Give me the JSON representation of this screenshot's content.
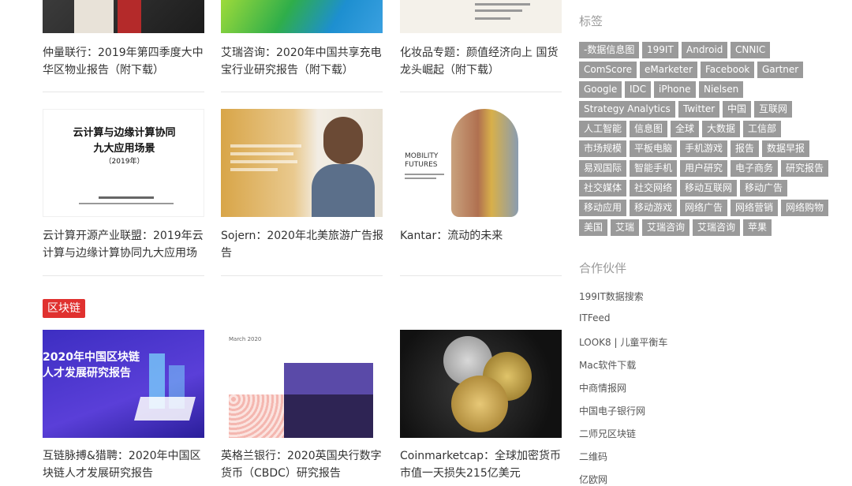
{
  "articles": [
    {
      "title": "仲量联行：2019年第四季度大中华区物业报告（附下载）"
    },
    {
      "title": "艾瑞咨询：2020年中国共享充电宝行业研究报告（附下载）"
    },
    {
      "title": "化妆品专题：颜值经济向上 国货龙头崛起（附下载）"
    },
    {
      "title": "云计算开源产业联盟：2019年云计算与边缘计算协同九大应用场"
    },
    {
      "title": "Sojern：2020年北美旅游广告报告"
    },
    {
      "title": "Kantar：流动的未来"
    },
    {
      "title": "互链脉搏&猎聘：2020年中国区块链人才发展研究报告"
    },
    {
      "title": "英格兰银行：2020英国央行数字货币（CBDC）研究报告"
    },
    {
      "title": "Coinmarketcap：全球加密货币市值一天损失215亿美元"
    }
  ],
  "thumb_text": {
    "cloud_line1": "云计算与边缘计算协同",
    "cloud_line2": "九大应用场景",
    "cloud_year": "（2019年）",
    "kantar_title": "MOBILITY FUTURES",
    "boe_date": "March 2020",
    "chain_line1": "2020年中国区块链",
    "chain_line2": "人才发展研究报告"
  },
  "category": {
    "label": "区块链"
  },
  "sidebar": {
    "tags_heading": "标签",
    "tags": [
      "-数据信息图",
      "199IT",
      "Android",
      "CNNIC",
      "ComScore",
      "eMarketer",
      "Facebook",
      "Gartner",
      "Google",
      "IDC",
      "iPhone",
      "Nielsen",
      "Strategy Analytics",
      "Twitter",
      "中国",
      "互联网",
      "人工智能",
      "信息图",
      "全球",
      "大数据",
      "工信部",
      "市场规模",
      "平板电脑",
      "手机游戏",
      "报告",
      "数据早报",
      "易观国际",
      "智能手机",
      "用户研究",
      "电子商务",
      "研究报告",
      "社交媒体",
      "社交网络",
      "移动互联网",
      "移动广告",
      "移动应用",
      "移动游戏",
      "网络广告",
      "网络营销",
      "网络购物",
      "美国",
      "艾瑞",
      "艾瑞咨询",
      "艾瑞咨询",
      "苹果"
    ],
    "partners_heading": "合作伙伴",
    "partners": [
      "199IT数据搜索",
      "ITFeed",
      "LOOK8 | 儿童平衡车",
      "Mac软件下载",
      "中商情报网",
      "中国电子银行网",
      "二师兄区块链",
      "二维码",
      "亿欧网"
    ]
  }
}
